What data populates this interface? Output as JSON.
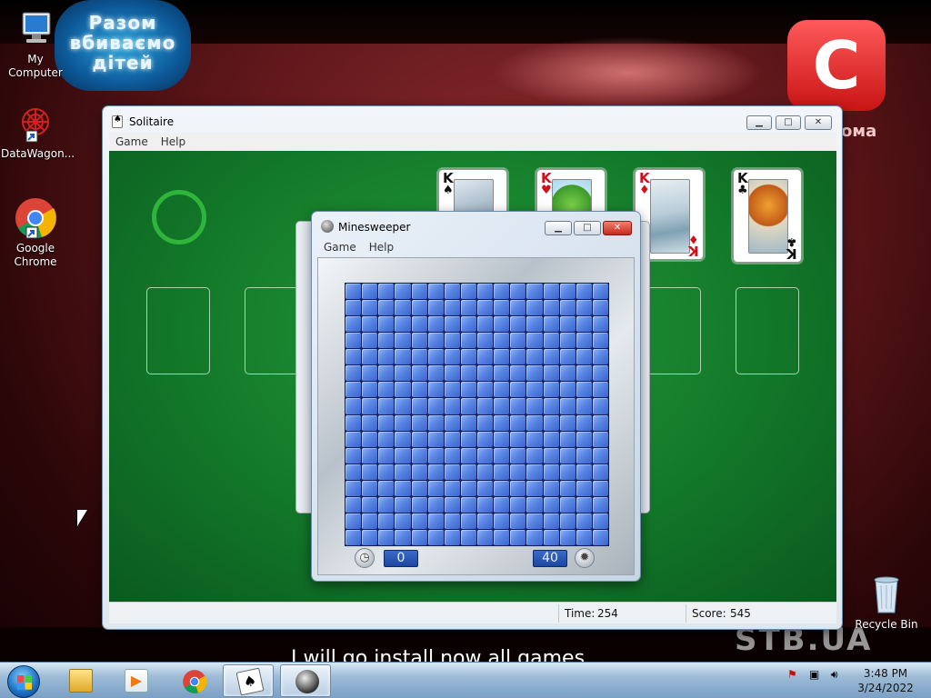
{
  "desktop": {
    "icons": [
      {
        "label": "My Computer",
        "icon": "computer-icon"
      },
      {
        "label": "DataWagon...",
        "icon": "datawagon-icon"
      },
      {
        "label": "Google Chrome",
        "icon": "chrome-icon"
      },
      {
        "label": "Recycle Bin",
        "icon": "recycle-bin-icon"
      }
    ],
    "overlay": {
      "logo_text": "Разом вбиваємо дітей",
      "channel_logo": "C",
      "channel_suffix": "ома",
      "watermark": "STB.UA",
      "subtitle": "I will go install now all games"
    }
  },
  "solitaire": {
    "title": "Solitaire",
    "menu": [
      "Game",
      "Help"
    ],
    "foundations": [
      {
        "rank": "K",
        "suit": "♠",
        "color": "black"
      },
      {
        "rank": "K",
        "suit": "♥",
        "color": "red"
      },
      {
        "rank": "K",
        "suit": "♦",
        "color": "red"
      },
      {
        "rank": "K",
        "suit": "♣",
        "color": "black"
      }
    ],
    "status": {
      "time_label": "Time:",
      "time_value": "254",
      "score_label": "Score:",
      "score_value": "545"
    }
  },
  "minesweeper": {
    "title": "Minesweeper",
    "menu": [
      "Game",
      "Help"
    ],
    "grid": {
      "rows": 16,
      "cols": 16
    },
    "timer": "0",
    "mines_left": "40",
    "accent": "#3a64cc"
  },
  "taskbar": {
    "items": [
      "explorer-icon",
      "media-player-icon",
      "chrome-icon",
      "solitaire-icon",
      "minesweeper-icon"
    ],
    "active": "minesweeper-icon",
    "clock_time": "3:48 PM",
    "clock_date": "3/24/2022"
  }
}
